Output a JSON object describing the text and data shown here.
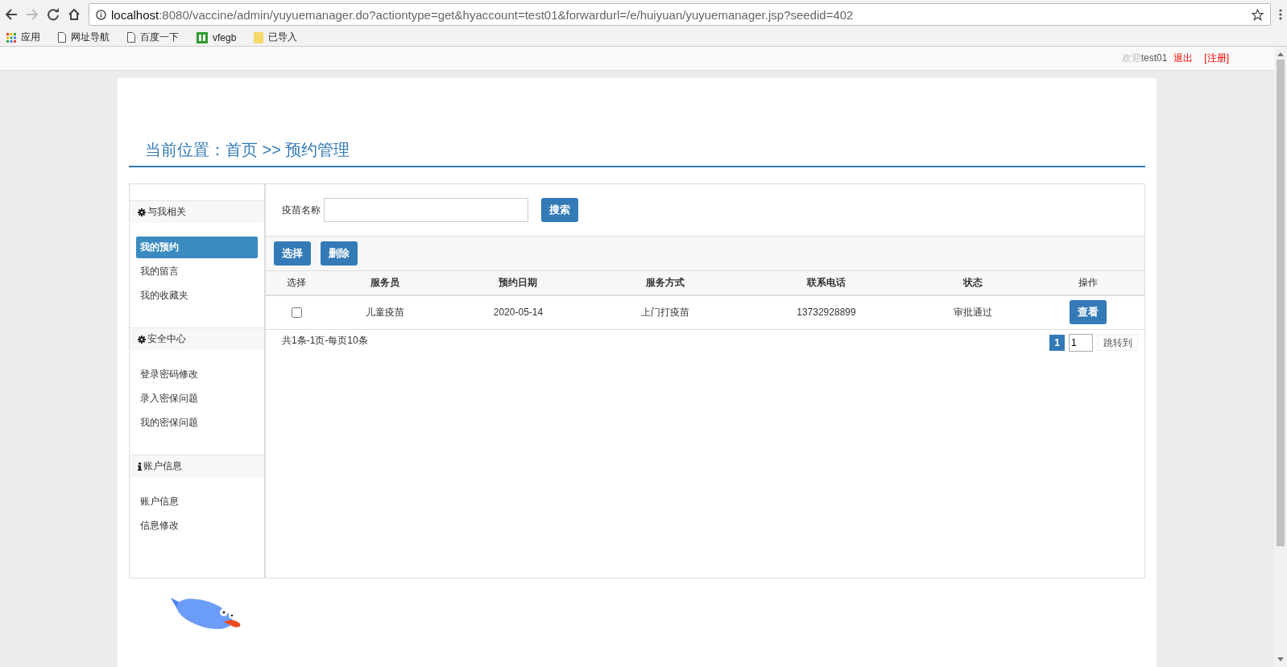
{
  "browser": {
    "url_host": "localhost",
    "url_rest": ":8080/vaccine/admin/yuyuemanager.do?actiontype=get&hyaccount=test01&forwardurl=/e/huiyuan/yuyuemanager.jsp?seedid=402",
    "bookmarks": [
      {
        "kind": "apps",
        "label": "应用"
      },
      {
        "kind": "page",
        "label": "网址导航"
      },
      {
        "kind": "page",
        "label": "百度一下"
      },
      {
        "kind": "grid",
        "label": "vfegb"
      },
      {
        "kind": "folder",
        "label": "已导入"
      }
    ]
  },
  "header": {
    "welcome": "欢迎",
    "user": "test01",
    "logout": "退出",
    "register": "[注册]"
  },
  "breadcrumb": "当前位置：首页 >> 预约管理",
  "sidebar": [
    {
      "title": "与我相关",
      "kind": "gear",
      "items": [
        {
          "label": "我的预约",
          "selected": true
        },
        {
          "label": "我的留言",
          "selected": false
        },
        {
          "label": "我的收藏夹",
          "selected": false
        }
      ]
    },
    {
      "title": "安全中心",
      "kind": "gear",
      "items": [
        {
          "label": "登录密码修改",
          "selected": false
        },
        {
          "label": "录入密保问题",
          "selected": false
        },
        {
          "label": "我的密保问题",
          "selected": false
        }
      ]
    },
    {
      "title": "账户信息",
      "kind": "info",
      "items": [
        {
          "label": "账户信息",
          "selected": false
        },
        {
          "label": "信息修改",
          "selected": false
        }
      ]
    }
  ],
  "search": {
    "label": "疫苗名称",
    "button": "搜索"
  },
  "toolbar": [
    "选择",
    "删除"
  ],
  "table": {
    "columns": [
      "选择",
      "服务员",
      "预约日期",
      "服务方式",
      "联系电话",
      "状态",
      "操作"
    ],
    "rows": [
      {
        "cells": [
          {
            "kind": "checkbox",
            "checked": false
          },
          {
            "kind": "text",
            "text": "儿童疫苗"
          },
          {
            "kind": "text",
            "text": "2020-05-14"
          },
          {
            "kind": "text",
            "text": "上门打疫苗"
          },
          {
            "kind": "text",
            "text": "13732928899"
          },
          {
            "kind": "text",
            "text": "审批通过"
          },
          {
            "kind": "button",
            "text": "查看"
          }
        ]
      }
    ]
  },
  "pagination": {
    "summary": "共1条-1页-每页10条",
    "pages": [
      {
        "label": "1",
        "selected": true
      }
    ],
    "jump_value": "1",
    "jump_button": "跳转到"
  }
}
